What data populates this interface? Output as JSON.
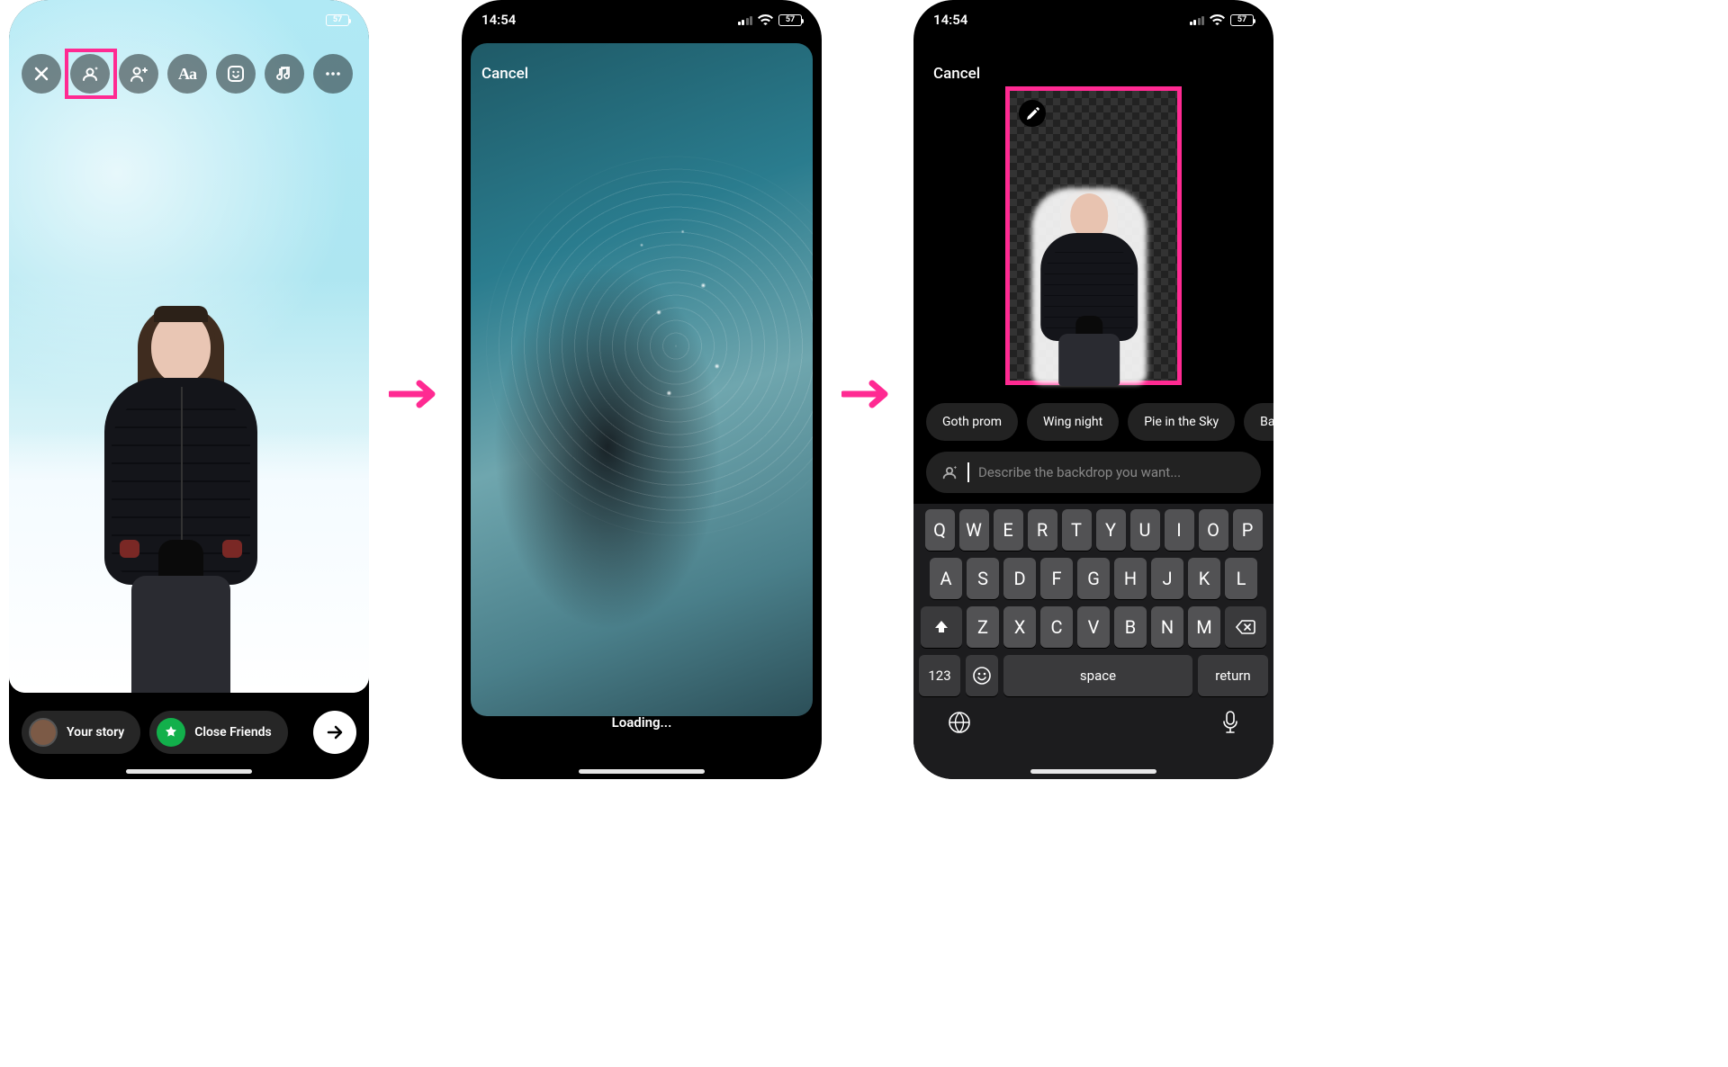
{
  "status": {
    "time": "14:54",
    "battery": "57"
  },
  "phone1": {
    "toolbar_icons": [
      "close",
      "ai-backdrop",
      "tag-people",
      "text",
      "sticker",
      "music",
      "more"
    ],
    "your_story_label": "Your story",
    "close_friends_label": "Close Friends"
  },
  "phone2": {
    "cancel": "Cancel",
    "loading": "Loading..."
  },
  "phone3": {
    "cancel": "Cancel",
    "suggestions": [
      "Goth prom",
      "Wing night",
      "Pie in the Sky",
      "Basket"
    ],
    "prompt_placeholder": "Describe the backdrop you want...",
    "keyboard": {
      "row1": [
        "Q",
        "W",
        "E",
        "R",
        "T",
        "Y",
        "U",
        "I",
        "O",
        "P"
      ],
      "row2": [
        "A",
        "S",
        "D",
        "F",
        "G",
        "H",
        "J",
        "K",
        "L"
      ],
      "row3": [
        "Z",
        "X",
        "C",
        "V",
        "B",
        "N",
        "M"
      ],
      "num_key": "123",
      "space": "space",
      "return": "return"
    }
  },
  "highlight_color": "#ff2a92"
}
